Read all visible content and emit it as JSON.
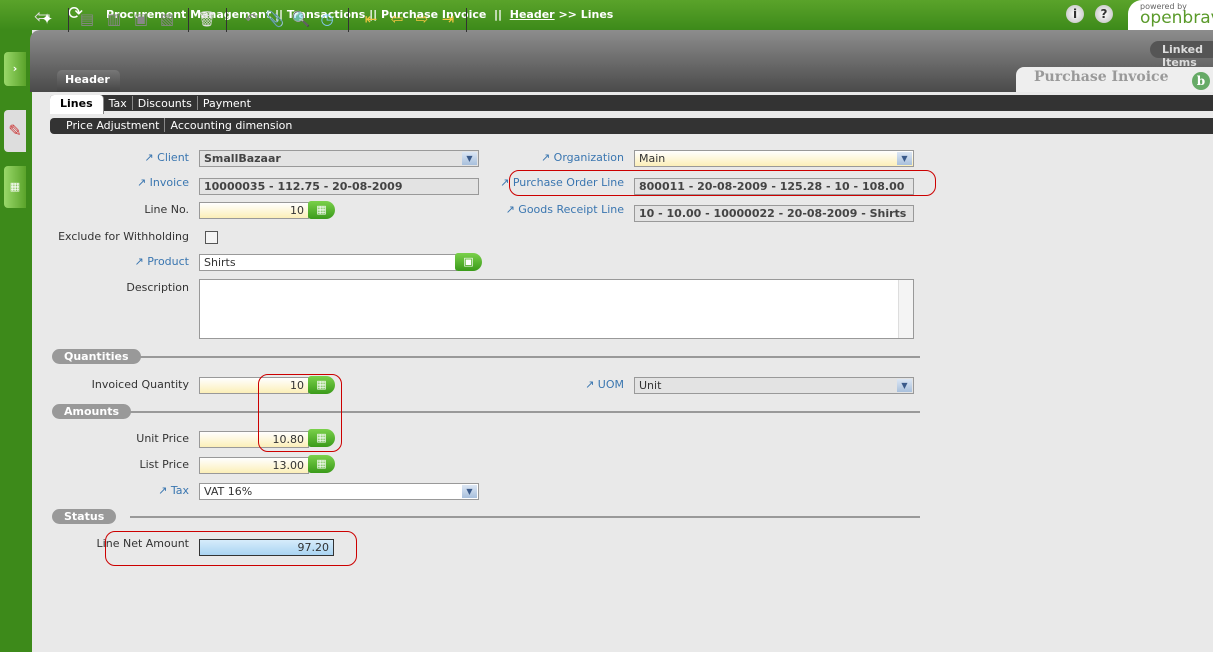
{
  "breadcrumb": {
    "part1": "Procurement Management",
    "part2": "Transactions",
    "part3": "Purchase Invoice",
    "header_link": "Header",
    "current": "Lines",
    "sep": "||",
    "arrow": ">>"
  },
  "logo": {
    "powered": "powered by",
    "name": "openbravo"
  },
  "toolbar": {
    "linked_items": "Linked Items",
    "window_title": "Purchase Invoice"
  },
  "tabs": {
    "header": "Header",
    "level1": [
      "Lines",
      "Tax",
      "Discounts",
      "Payment"
    ],
    "level2": [
      "Price Adjustment",
      "Accounting dimension"
    ]
  },
  "form": {
    "client": {
      "label": "Client",
      "value": "SmallBazaar"
    },
    "organization": {
      "label": "Organization",
      "value": "Main"
    },
    "invoice": {
      "label": "Invoice",
      "value": "10000035 - 112.75 - 20-08-2009"
    },
    "po_line": {
      "label": "Purchase Order Line",
      "value": "800011 - 20-08-2009 - 125.28 - 10 - 108.00"
    },
    "line_no": {
      "label": "Line No.",
      "value": "10"
    },
    "gr_line": {
      "label": "Goods Receipt Line",
      "value": "10 - 10.00 - 10000022 - 20-08-2009 - Shirts"
    },
    "exclude": {
      "label": "Exclude for Withholding",
      "checked": false
    },
    "product": {
      "label": "Product",
      "value": "Shirts"
    },
    "description": {
      "label": "Description",
      "value": ""
    }
  },
  "sections": {
    "quantities": "Quantities",
    "amounts": "Amounts",
    "status": "Status"
  },
  "quantities": {
    "invoiced_qty": {
      "label": "Invoiced Quantity",
      "value": "10"
    },
    "uom": {
      "label": "UOM",
      "value": "Unit"
    }
  },
  "amounts": {
    "unit_price": {
      "label": "Unit Price",
      "value": "10.80"
    },
    "list_price": {
      "label": "List Price",
      "value": "13.00"
    },
    "tax": {
      "label": "Tax",
      "value": "VAT 16%"
    }
  },
  "status": {
    "line_net_amount": {
      "label": "Line Net Amount",
      "value": "97.20"
    }
  }
}
